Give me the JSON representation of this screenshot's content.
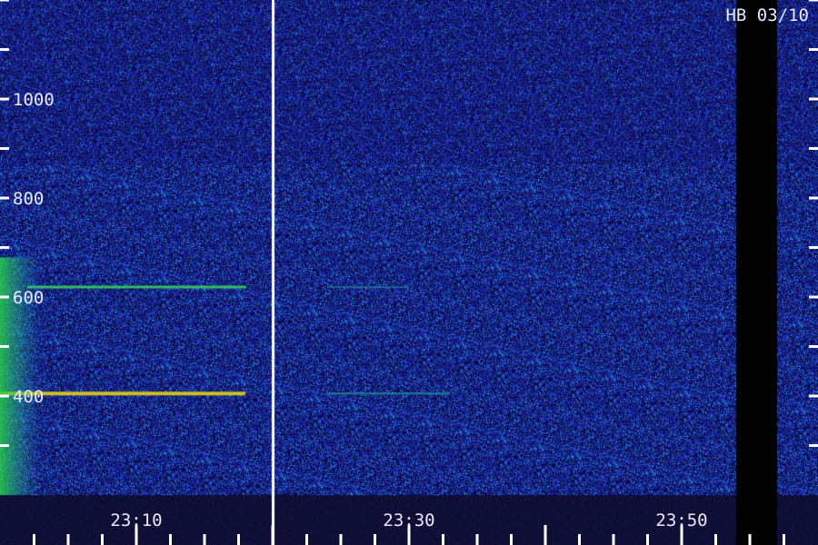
{
  "chart_data": {
    "type": "heatmap",
    "title": "HB 03/10",
    "xlabel": "",
    "ylabel": "",
    "x_ticks": [
      "23:10",
      "23:30",
      "23:50"
    ],
    "x_range": [
      "23:00",
      "00:00"
    ],
    "y_ticks": [
      400,
      600,
      800,
      1000
    ],
    "y_range": [
      200,
      1200
    ],
    "gap": {
      "start": "23:54",
      "end": "23:57"
    },
    "panel_divider": "23:20",
    "features": [
      {
        "type": "horizontal_line",
        "y": 405,
        "x_start": "23:00",
        "x_end": "23:18",
        "intensity": "high",
        "color": "#d0c020"
      },
      {
        "type": "horizontal_line",
        "y": 620,
        "x_start": "23:02",
        "x_end": "23:18",
        "intensity": "medium",
        "color": "#30c060"
      },
      {
        "type": "horizontal_line",
        "y": 405,
        "x_start": "23:24",
        "x_end": "23:33",
        "intensity": "low",
        "color": "#20a8a0"
      },
      {
        "type": "horizontal_line",
        "y": 620,
        "x_start": "23:24",
        "x_end": "23:30",
        "intensity": "low",
        "color": "#2080a0"
      },
      {
        "type": "broadband_patch",
        "y_range": [
          200,
          680
        ],
        "x_start": "23:00",
        "x_end": "23:03",
        "intensity": "high",
        "color": "#20c040"
      }
    ],
    "colors": {
      "background": "#0a0838",
      "noise": "#2038c0",
      "label": "#e8e8ff",
      "gap": "#000000"
    }
  }
}
